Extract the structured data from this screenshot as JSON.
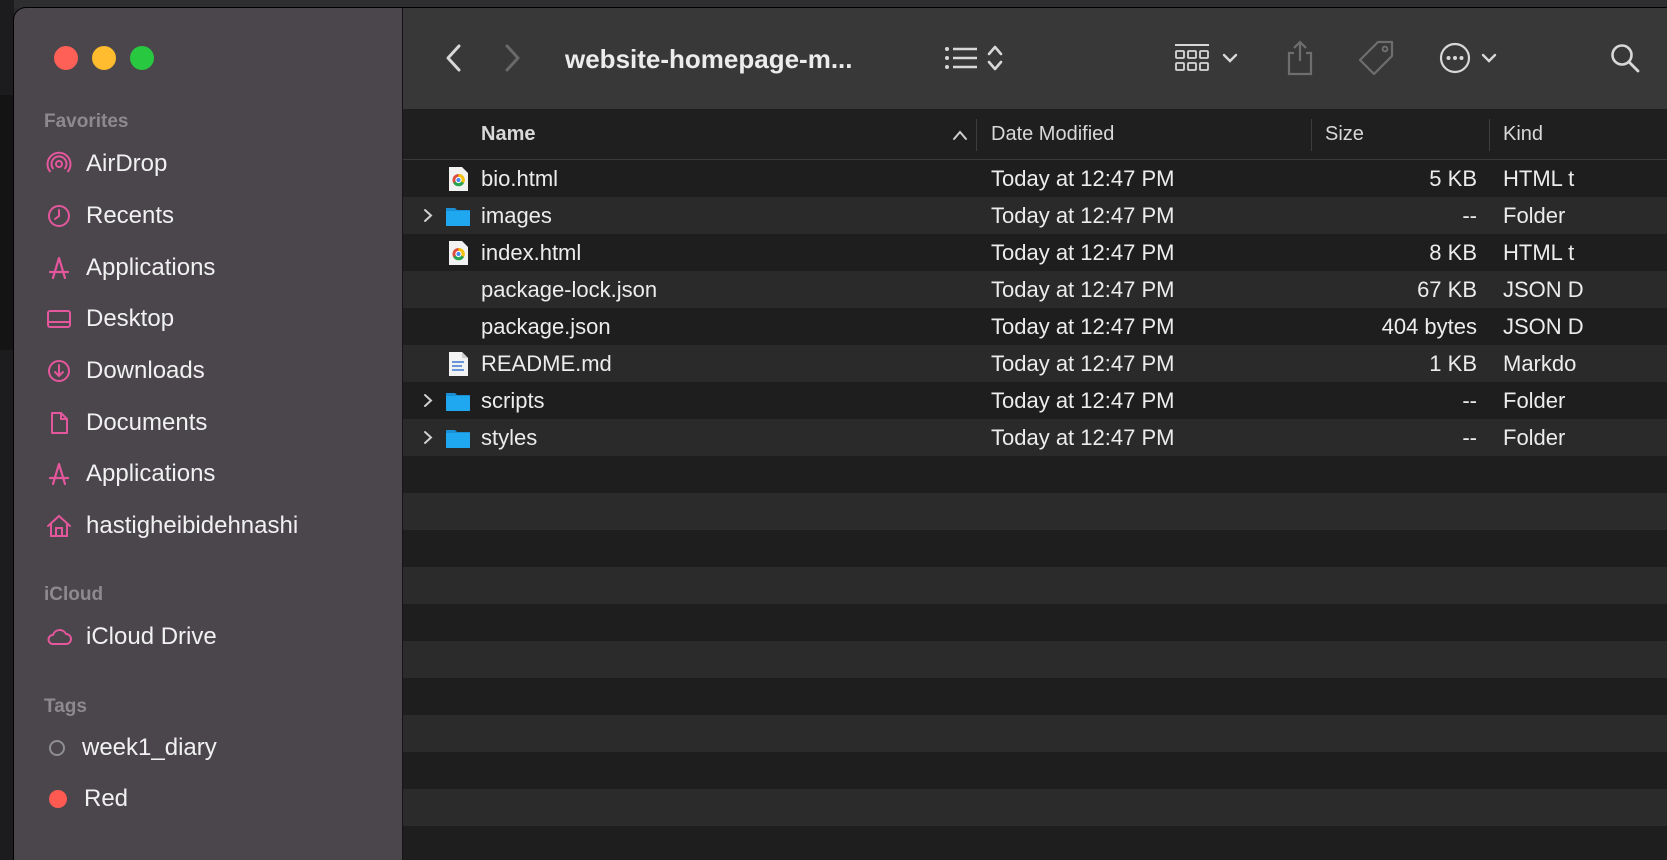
{
  "toolbar": {
    "title": "website-homepage-m...",
    "back_label": "‹",
    "forward_label": "›"
  },
  "sidebar": {
    "favorites_header": "Favorites",
    "favorites": [
      {
        "label": "AirDrop",
        "icon": "airdrop-icon"
      },
      {
        "label": "Recents",
        "icon": "clock-icon"
      },
      {
        "label": "Applications",
        "icon": "applications-icon"
      },
      {
        "label": "Desktop",
        "icon": "desktop-icon"
      },
      {
        "label": "Downloads",
        "icon": "download-icon"
      },
      {
        "label": "Documents",
        "icon": "document-icon"
      },
      {
        "label": "Applications",
        "icon": "applications-icon"
      },
      {
        "label": "hastigheibidehnashi",
        "icon": "home-icon"
      }
    ],
    "icloud_header": "iCloud",
    "icloud": [
      {
        "label": "iCloud Drive",
        "icon": "cloud-icon"
      }
    ],
    "tags_header": "Tags",
    "tags": [
      {
        "label": "week1_diary",
        "color": "#8e8e93",
        "hollow": true
      },
      {
        "label": "Red",
        "color": "#ff5a52",
        "hollow": false
      }
    ]
  },
  "columns": {
    "name": "Name",
    "date": "Date Modified",
    "size": "Size",
    "kind": "Kind"
  },
  "files": [
    {
      "name": "bio.html",
      "date": "Today at 12:47 PM",
      "size": "5 KB",
      "kind": "HTML t",
      "type": "html"
    },
    {
      "name": "images",
      "date": "Today at 12:47 PM",
      "size": "--",
      "kind": "Folder",
      "type": "folder"
    },
    {
      "name": "index.html",
      "date": "Today at 12:47 PM",
      "size": "8 KB",
      "kind": "HTML t",
      "type": "html"
    },
    {
      "name": "package-lock.json",
      "date": "Today at 12:47 PM",
      "size": "67 KB",
      "kind": "JSON D",
      "type": "none"
    },
    {
      "name": "package.json",
      "date": "Today at 12:47 PM",
      "size": "404 bytes",
      "kind": "JSON D",
      "type": "none"
    },
    {
      "name": "README.md",
      "date": "Today at 12:47 PM",
      "size": "1 KB",
      "kind": "Markdo",
      "type": "md"
    },
    {
      "name": "scripts",
      "date": "Today at 12:47 PM",
      "size": "--",
      "kind": "Folder",
      "type": "folder"
    },
    {
      "name": "styles",
      "date": "Today at 12:47 PM",
      "size": "--",
      "kind": "Folder",
      "type": "folder"
    }
  ],
  "colors": {
    "accent_pink": "#e4579c",
    "folder_blue": "#1fa7f0"
  }
}
